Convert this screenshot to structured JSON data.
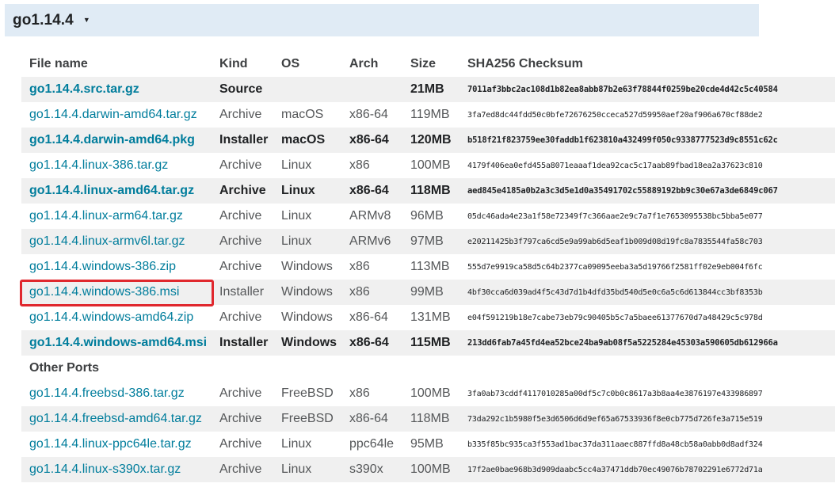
{
  "version": {
    "title": "go1.14.4",
    "toggle_icon": "▼"
  },
  "columns": [
    "File name",
    "Kind",
    "OS",
    "Arch",
    "Size",
    "SHA256 Checksum"
  ],
  "files": [
    {
      "name": "go1.14.4.src.tar.gz",
      "kind": "Source",
      "os": "",
      "arch": "",
      "size": "21MB",
      "sha": "7011af3bbc2ac108d1b82ea8abb87b2e63f78844f0259be20cde4d42c5c40584",
      "highlight": true
    },
    {
      "name": "go1.14.4.darwin-amd64.tar.gz",
      "kind": "Archive",
      "os": "macOS",
      "arch": "x86-64",
      "size": "119MB",
      "sha": "3fa7ed8dc44fdd50c0bfe72676250cceca527d59950aef20af906a670cf88de2",
      "highlight": false
    },
    {
      "name": "go1.14.4.darwin-amd64.pkg",
      "kind": "Installer",
      "os": "macOS",
      "arch": "x86-64",
      "size": "120MB",
      "sha": "b518f21f823759ee30faddb1f623810a432499f050c9338777523d9c8551c62c",
      "highlight": true
    },
    {
      "name": "go1.14.4.linux-386.tar.gz",
      "kind": "Archive",
      "os": "Linux",
      "arch": "x86",
      "size": "100MB",
      "sha": "4179f406ea0efd455a8071eaaaf1dea92cac5c17aab89fbad18ea2a37623c810",
      "highlight": false
    },
    {
      "name": "go1.14.4.linux-amd64.tar.gz",
      "kind": "Archive",
      "os": "Linux",
      "arch": "x86-64",
      "size": "118MB",
      "sha": "aed845e4185a0b2a3c3d5e1d0a35491702c55889192bb9c30e67a3de6849c067",
      "highlight": true
    },
    {
      "name": "go1.14.4.linux-arm64.tar.gz",
      "kind": "Archive",
      "os": "Linux",
      "arch": "ARMv8",
      "size": "96MB",
      "sha": "05dc46ada4e23a1f58e72349f7c366aae2e9c7a7f1e7653095538bc5bba5e077",
      "highlight": false
    },
    {
      "name": "go1.14.4.linux-armv6l.tar.gz",
      "kind": "Archive",
      "os": "Linux",
      "arch": "ARMv6",
      "size": "97MB",
      "sha": "e20211425b3f797ca6cd5e9a99ab6d5eaf1b009d08d19fc8a7835544fa58c703",
      "highlight": false
    },
    {
      "name": "go1.14.4.windows-386.zip",
      "kind": "Archive",
      "os": "Windows",
      "arch": "x86",
      "size": "113MB",
      "sha": "555d7e9919ca58d5c64b2377ca09095eeba3a5d19766f2581ff02e9eb004f6fc",
      "highlight": false
    },
    {
      "name": "go1.14.4.windows-386.msi",
      "kind": "Installer",
      "os": "Windows",
      "arch": "x86",
      "size": "99MB",
      "sha": "4bf30cca6d039ad4f5c43d7d1b4dfd35bd540d5e0c6a5c6d613844cc3bf8353b",
      "highlight": false,
      "selected": true
    },
    {
      "name": "go1.14.4.windows-amd64.zip",
      "kind": "Archive",
      "os": "Windows",
      "arch": "x86-64",
      "size": "131MB",
      "sha": "e04f591219b18e7cabe73eb79c90405b5c7a5baee61377670d7a48429c5c978d",
      "highlight": false
    },
    {
      "name": "go1.14.4.windows-amd64.msi",
      "kind": "Installer",
      "os": "Windows",
      "arch": "x86-64",
      "size": "115MB",
      "sha": "213dd6fab7a45fd4ea52bce24ba9ab08f5a5225284e45303a590605db612966a",
      "highlight": true
    }
  ],
  "other_ports_label": "Other Ports",
  "other_ports": [
    {
      "name": "go1.14.4.freebsd-386.tar.gz",
      "kind": "Archive",
      "os": "FreeBSD",
      "arch": "x86",
      "size": "100MB",
      "sha": "3fa0ab73cddf4117010285a00df5c7c0b0c8617a3b8aa4e3876197e433986897",
      "highlight": false
    },
    {
      "name": "go1.14.4.freebsd-amd64.tar.gz",
      "kind": "Archive",
      "os": "FreeBSD",
      "arch": "x86-64",
      "size": "118MB",
      "sha": "73da292c1b5980f5e3d6506d6d9ef65a67533936f8e0cb775d726fe3a715e519",
      "highlight": false
    },
    {
      "name": "go1.14.4.linux-ppc64le.tar.gz",
      "kind": "Archive",
      "os": "Linux",
      "arch": "ppc64le",
      "size": "95MB",
      "sha": "b335f85bc935ca3f553ad1bac37da311aaec887ffd8a48cb58a0abb0d8adf324",
      "highlight": false
    },
    {
      "name": "go1.14.4.linux-s390x.tar.gz",
      "kind": "Archive",
      "os": "Linux",
      "arch": "s390x",
      "size": "100MB",
      "sha": "17f2ae0bae968b3d909daabc5cc4a37471ddb70ec49076b78702291e6772d71a",
      "highlight": false
    }
  ],
  "colors": {
    "header_bg": "#e0ebf5",
    "link": "#007d9c",
    "stripe": "#f0f0f0",
    "selection_border": "#e0282e"
  },
  "icons": {
    "toggle": "caret-down-icon"
  }
}
